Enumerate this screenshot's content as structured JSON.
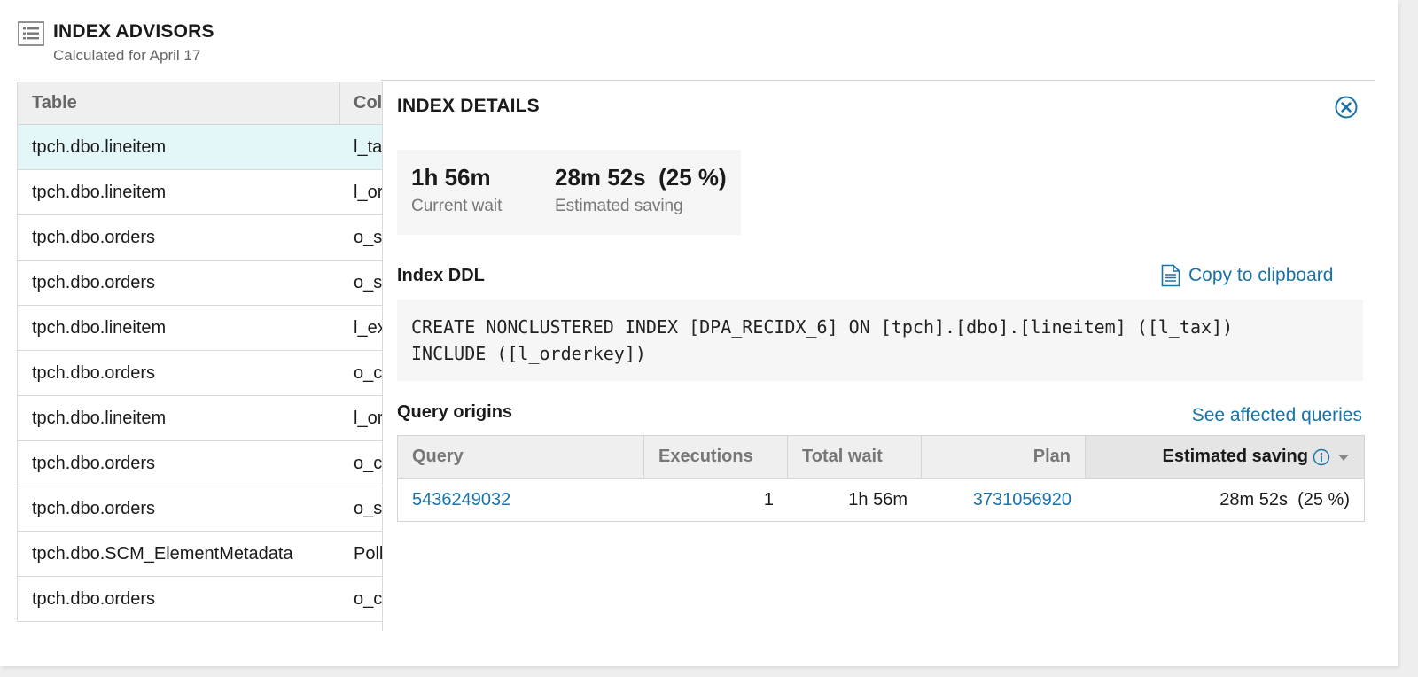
{
  "header": {
    "title": "INDEX ADVISORS",
    "subtitle": "Calculated for April 17"
  },
  "left_table": {
    "columns": [
      "Table",
      "Col"
    ],
    "rows": [
      {
        "table": "tpch.dbo.lineitem",
        "col": "l_ta"
      },
      {
        "table": "tpch.dbo.lineitem",
        "col": "l_or"
      },
      {
        "table": "tpch.dbo.orders",
        "col": "o_s"
      },
      {
        "table": "tpch.dbo.orders",
        "col": "o_s"
      },
      {
        "table": "tpch.dbo.lineitem",
        "col": "l_ex"
      },
      {
        "table": "tpch.dbo.orders",
        "col": "o_c"
      },
      {
        "table": "tpch.dbo.lineitem",
        "col": "l_or"
      },
      {
        "table": "tpch.dbo.orders",
        "col": "o_c"
      },
      {
        "table": "tpch.dbo.orders",
        "col": "o_s"
      },
      {
        "table": "tpch.dbo.SCM_ElementMetadata",
        "col": "Poll"
      },
      {
        "table": "tpch.dbo.orders",
        "col": "o_c"
      }
    ]
  },
  "details": {
    "title": "INDEX DETAILS",
    "current_wait_value": "1h 56m",
    "current_wait_label": "Current wait",
    "saving_value": "28m 52s  (25 %)",
    "saving_label": "Estimated saving",
    "ddl_label": "Index DDL",
    "copy_label": "Copy to clipboard",
    "ddl_text": "CREATE NONCLUSTERED INDEX [DPA_RECIDX_6] ON [tpch].[dbo].[lineitem] ([l_tax])\nINCLUDE ([l_orderkey])",
    "origins_label": "Query origins",
    "see_affected": "See affected queries",
    "query_columns": {
      "query": "Query",
      "executions": "Executions",
      "total_wait": "Total wait",
      "plan": "Plan",
      "estimated_saving": "Estimated saving"
    },
    "query_rows": [
      {
        "query": "5436249032",
        "executions": "1",
        "total_wait": "1h 56m",
        "plan": "3731056920",
        "estimated_saving": "28m 52s  (25 %)"
      }
    ]
  },
  "icons": {
    "header": "list-icon",
    "close": "close-circle-icon",
    "copy": "document-icon",
    "info": "info-icon",
    "sort": "sort-down-icon"
  },
  "colors": {
    "link": "#1a73a8",
    "selected_row": "#e3f7f9"
  }
}
